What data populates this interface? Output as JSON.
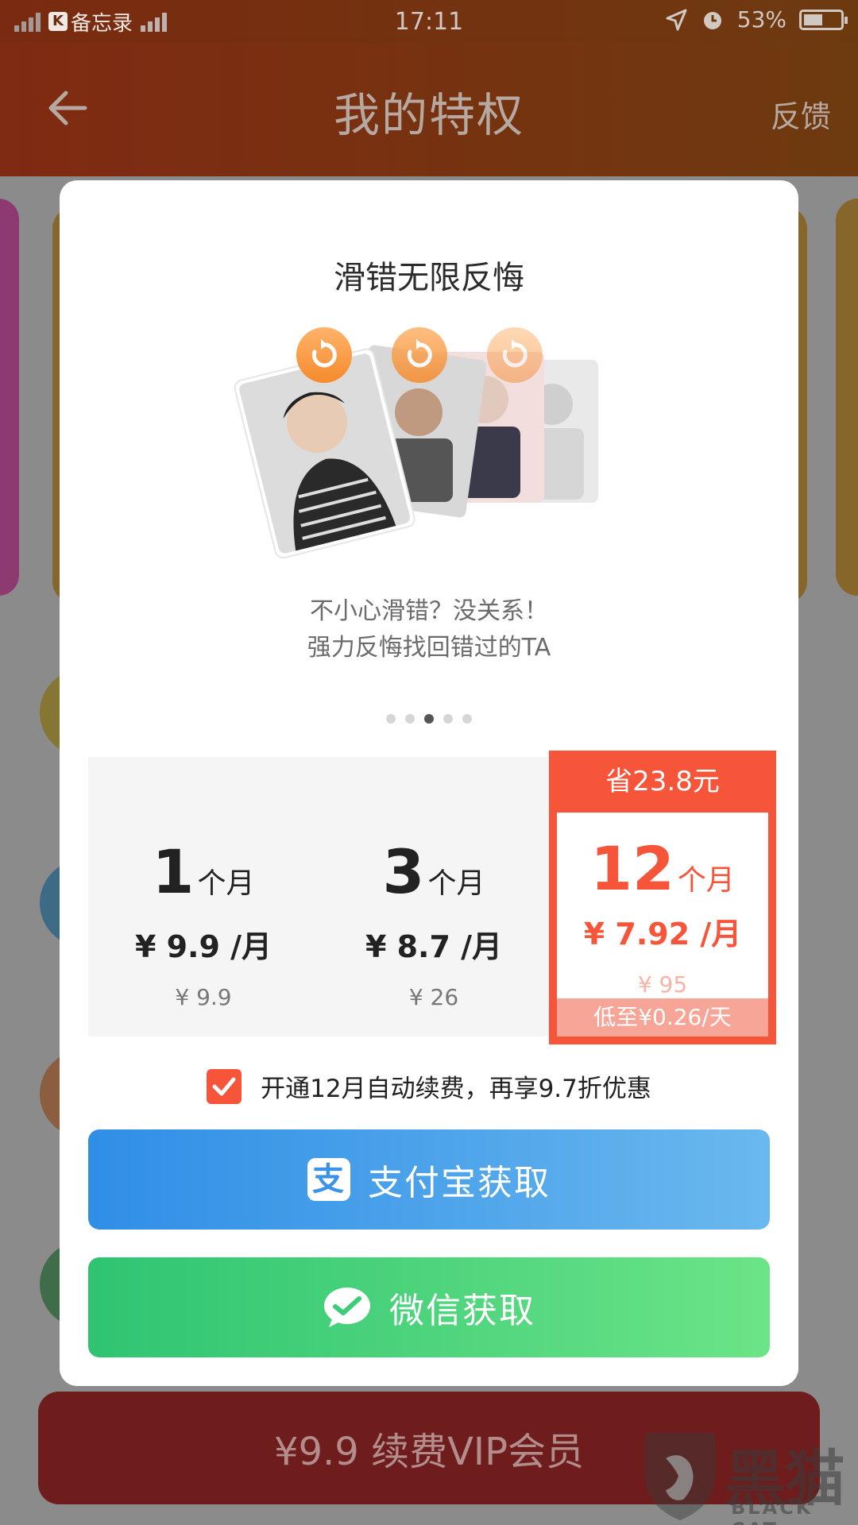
{
  "status_bar": {
    "back_app": "备忘录",
    "time": "17:11",
    "battery_text": "53%",
    "battery_level": 0.53
  },
  "header": {
    "title": "我的特权",
    "feedback": "反馈"
  },
  "modal": {
    "title": "滑错无限反悔",
    "desc_line1": "不小心滑错？没关系！",
    "desc_line2": "强力反悔找回错过的TA",
    "carousel_total": 5,
    "carousel_active": 3,
    "plans": [
      {
        "num": "1",
        "unit": "个月",
        "per": "¥ 9.9 /月",
        "total": "¥ 9.9"
      },
      {
        "num": "3",
        "unit": "个月",
        "per": "¥ 8.7 /月",
        "total": "¥ 26"
      }
    ],
    "best_plan": {
      "save": "省23.8元",
      "num": "12",
      "unit": "个月",
      "per": "¥ 7.92 /月",
      "total": "¥ 95",
      "per_day": "低至¥0.26/天"
    },
    "auto_renew": "开通12月自动续费，再享9.7折优惠",
    "alipay_icon_text": "支",
    "alipay_label": "支付宝获取",
    "wechat_label": "微信获取"
  },
  "bottom": {
    "renew_label": "¥9.9 续费VIP会员"
  },
  "watermark": {
    "cn": "黑猫",
    "en": "BLACK CAT"
  },
  "colors": {
    "accent": "#f6553a",
    "alipay": "#2f8ee6",
    "wechat": "#2fc472"
  }
}
